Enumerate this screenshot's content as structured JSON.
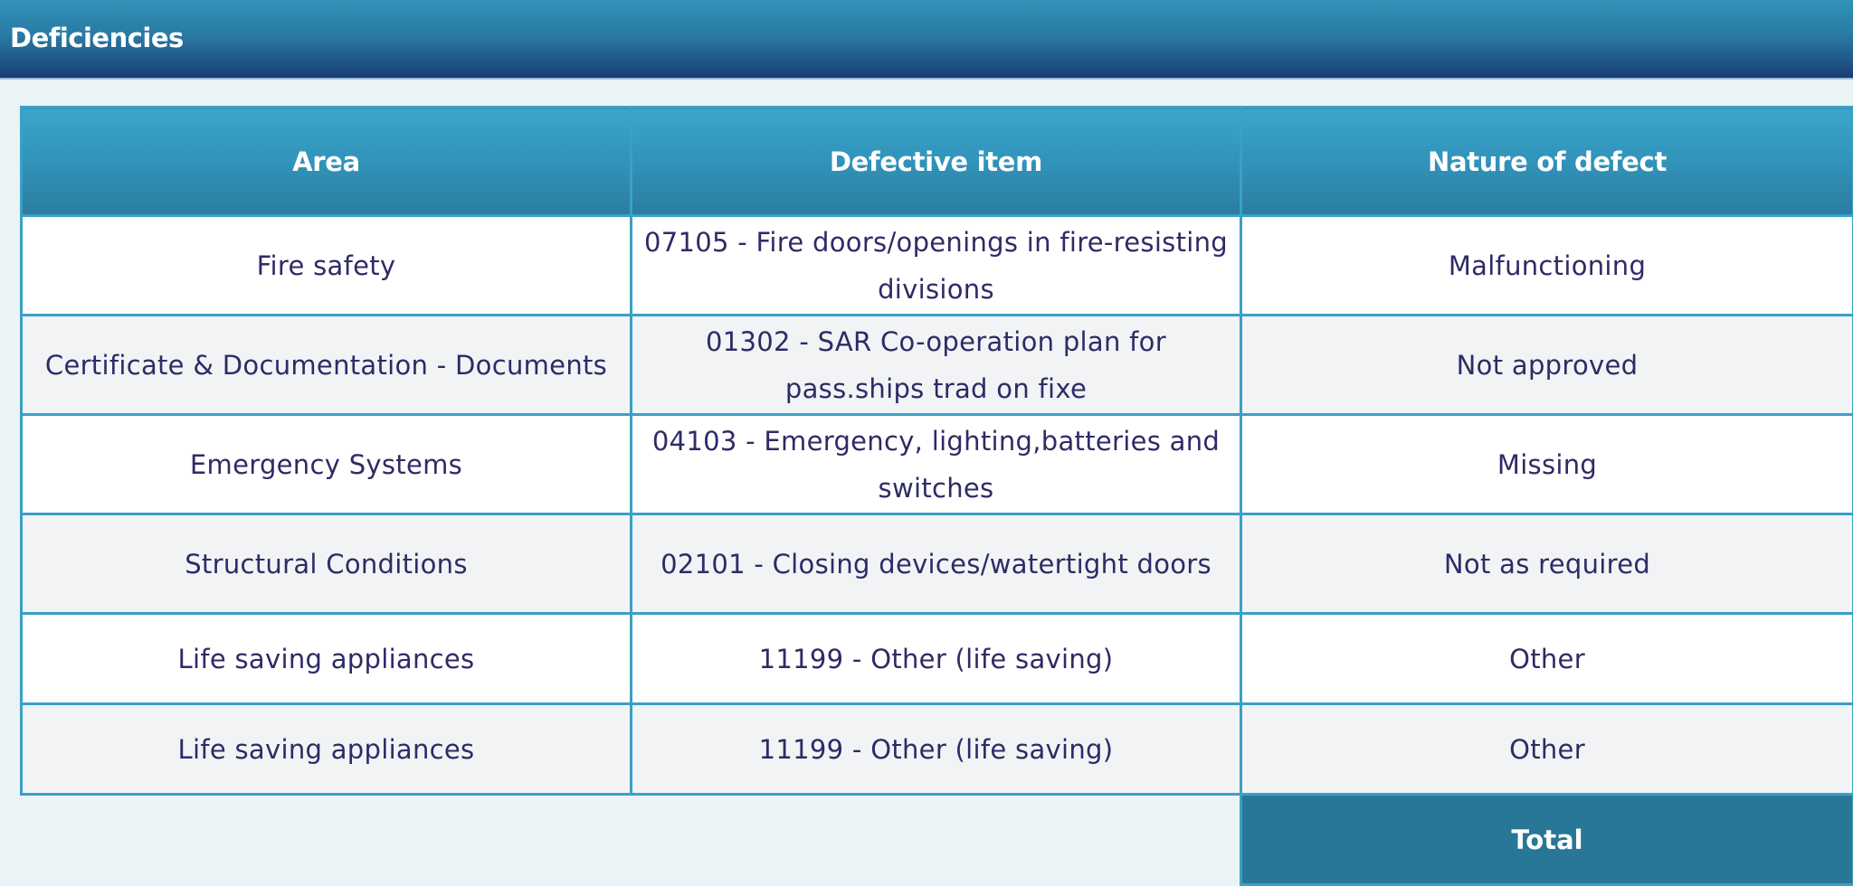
{
  "panel": {
    "title": "Deficiencies"
  },
  "table": {
    "columns": [
      "Area",
      "Defective item",
      "Nature of defect"
    ],
    "rows": [
      {
        "area": "Fire safety",
        "defective_item": "07105 - Fire doors/openings in fire-resisting divisions",
        "nature": "Malfunctioning"
      },
      {
        "area": "Certificate & Documentation - Documents",
        "defective_item": "01302 - SAR Co-operation plan for pass.ships trad on fixe",
        "nature": "Not approved"
      },
      {
        "area": "Emergency Systems",
        "defective_item": "04103 - Emergency, lighting,batteries and switches",
        "nature": "Missing"
      },
      {
        "area": "Structural Conditions",
        "defective_item": "02101 - Closing devices/watertight doors",
        "nature": "Not as required"
      },
      {
        "area": "Life saving appliances",
        "defective_item": "11199 - Other (life saving)",
        "nature": "Other"
      },
      {
        "area": "Life saving appliances",
        "defective_item": "11199 - Other (life saving)",
        "nature": "Other"
      }
    ],
    "total_label": "Total"
  },
  "colors": {
    "header_bg": "#3193b9",
    "title_bar_dark": "#1b3c70",
    "total_bg": "#287796",
    "border": "#3aa0c8",
    "text": "#2e2b66",
    "page_bg": "#eaf4f7"
  }
}
